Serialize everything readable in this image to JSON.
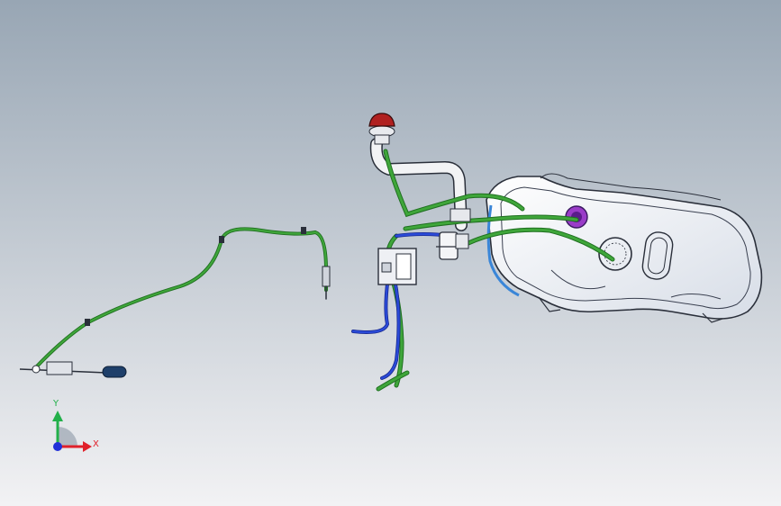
{
  "viewport": {
    "background_top": "#98a6b4",
    "background_bottom": "#f2f2f4"
  },
  "triad": {
    "x_label": "X",
    "y_label": "Y",
    "x_color": "#e0202a",
    "y_color": "#22b04a",
    "z_color": "#2030d8"
  },
  "model": {
    "hose_color": "#3fa63a",
    "hose_dark": "#1f6f20",
    "blue_line_color": "#2a4ad8",
    "blue_line_dark": "#1a2a90",
    "tank_fill": "#eef1f6",
    "tank_edge": "#2a2f3a",
    "cap_color": "#b02020",
    "sender_color": "#9a3cc8"
  }
}
